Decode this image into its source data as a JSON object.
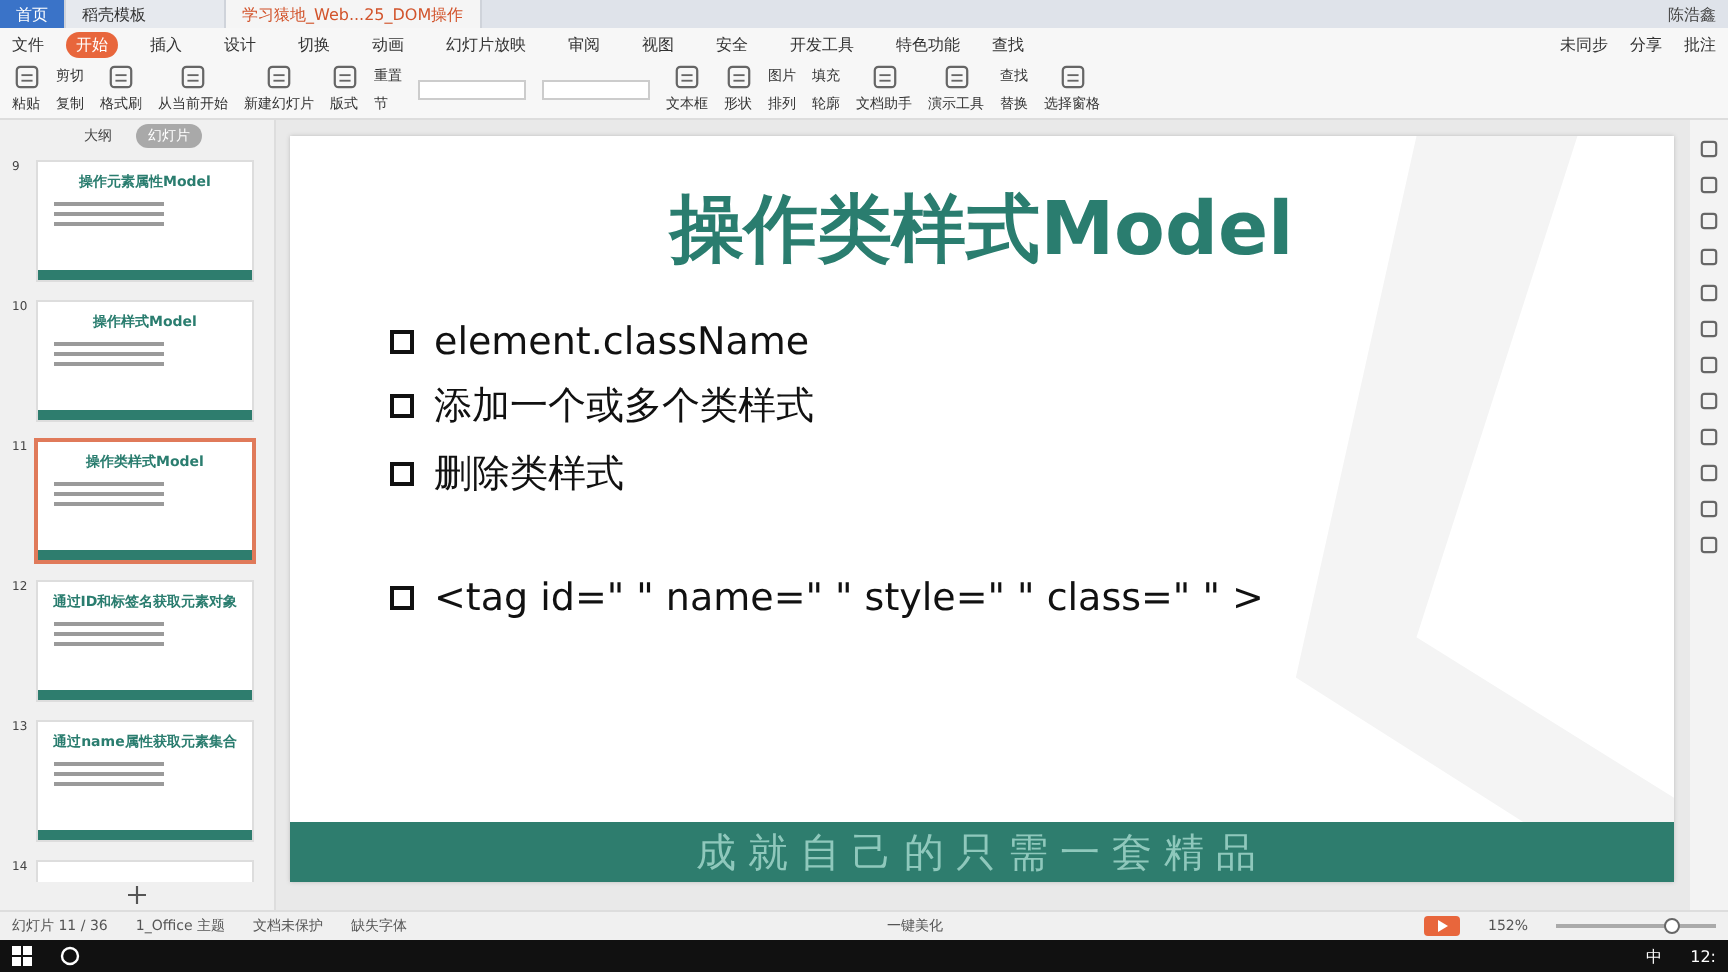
{
  "tabs": [
    {
      "label": "首页",
      "kind": "home",
      "selected": false
    },
    {
      "label": "稻壳模板",
      "kind": "doc",
      "selected": false
    },
    {
      "label": "学习猿地_Web...25_DOM操作",
      "kind": "doc",
      "selected": true
    }
  ],
  "user": {
    "name": "陈浩鑫"
  },
  "menu": {
    "file": "文件",
    "items": [
      {
        "label": "开始",
        "selected": true
      },
      {
        "label": "插入",
        "selected": false
      },
      {
        "label": "设计",
        "selected": false
      },
      {
        "label": "切换",
        "selected": false
      },
      {
        "label": "动画",
        "selected": false
      },
      {
        "label": "幻灯片放映",
        "selected": false
      },
      {
        "label": "审阅",
        "selected": false
      },
      {
        "label": "视图",
        "selected": false
      },
      {
        "label": "安全",
        "selected": false
      },
      {
        "label": "开发工具",
        "selected": false
      },
      {
        "label": "特色功能",
        "selected": false
      }
    ],
    "search": "查找",
    "right": [
      "未同步",
      "分享",
      "批注"
    ]
  },
  "ribbon": {
    "groups": [
      {
        "kind": "big",
        "label": "粘贴"
      },
      {
        "kind": "stack",
        "labels": [
          "剪切",
          "复制"
        ]
      },
      {
        "kind": "big",
        "label": "格式刷"
      },
      {
        "kind": "big",
        "label": "从当前开始"
      },
      {
        "kind": "big",
        "label": "新建幻灯片"
      },
      {
        "kind": "big",
        "label": "版式"
      },
      {
        "kind": "stack",
        "labels": [
          "重置",
          "节"
        ]
      },
      {
        "kind": "fonts"
      },
      {
        "kind": "big",
        "label": "文本框"
      },
      {
        "kind": "big",
        "label": "形状"
      },
      {
        "kind": "stack",
        "labels": [
          "图片",
          "排列"
        ]
      },
      {
        "kind": "stack",
        "labels": [
          "填充",
          "轮廓"
        ]
      },
      {
        "kind": "big",
        "label": "文档助手"
      },
      {
        "kind": "big",
        "label": "演示工具"
      },
      {
        "kind": "stack",
        "labels": [
          "查找",
          "替换"
        ]
      },
      {
        "kind": "big",
        "label": "选择窗格"
      }
    ]
  },
  "panel": {
    "tabs": [
      {
        "label": "大纲",
        "selected": false
      },
      {
        "label": "幻灯片",
        "selected": true
      }
    ],
    "slides": [
      {
        "number": "9",
        "title": "操作元素属性Model",
        "selected": false
      },
      {
        "number": "10",
        "title": "操作样式Model",
        "selected": false
      },
      {
        "number": "11",
        "title": "操作类样式Model",
        "selected": true
      },
      {
        "number": "12",
        "title": "通过ID和标签名获取元素对象",
        "selected": false
      },
      {
        "number": "13",
        "title": "通过name属性获取元素集合",
        "selected": false
      },
      {
        "number": "14",
        "selected": false
      }
    ]
  },
  "slide": {
    "title": "操作类样式Model",
    "bullet_groups": [
      [
        "element.className",
        "添加一个或多个类样式",
        "删除类样式"
      ],
      [
        "<tag id=\" \" name=\" \" style=\" \" class=\" \" >"
      ]
    ],
    "footer": "成就自己的只需一套精品"
  },
  "status_bar": {
    "slide": "幻灯片 11 / 36",
    "theme": "1_Office 主题",
    "protect": "文档未保护",
    "font": "缺失字体",
    "beautify": "一键美化",
    "zoom": "152%",
    "level": 0.72
  },
  "taskbar": {
    "ime": "中",
    "time": "12:"
  }
}
